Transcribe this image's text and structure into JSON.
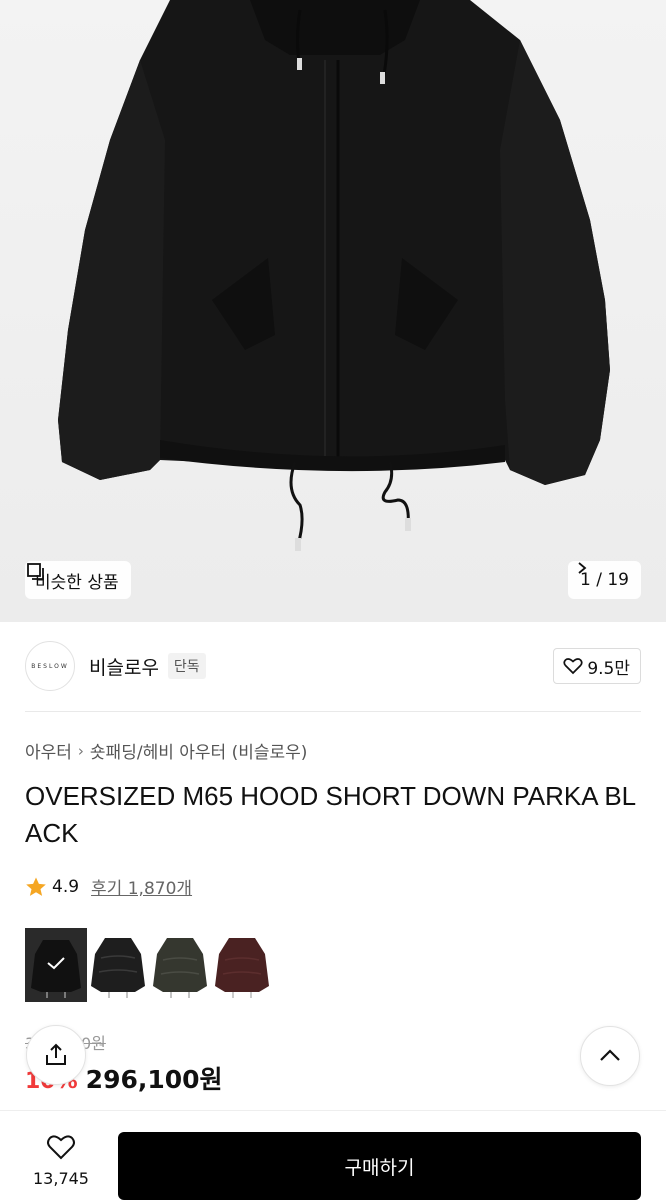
{
  "gallery": {
    "similar_label": "비슷한 상품",
    "counter": "1 / 19"
  },
  "brand": {
    "logo_text": "BESLOW",
    "name": "비슬로우",
    "badge": "단독",
    "likes": "9.5만"
  },
  "breadcrumb": {
    "items": [
      "아우터",
      "숏패딩/헤비 아우터 (비슬로우)"
    ]
  },
  "product": {
    "title": "OVERSIZED M65 HOOD SHORT DOWN PARKA BLACK",
    "rating": "4.9",
    "reviews": "후기 1,870개",
    "original_price": "329,000원",
    "discount": "10%",
    "sale_price": "296,100원"
  },
  "swatches": [
    {
      "color_name": "black",
      "hex": "#1a1a1a",
      "selected": true
    },
    {
      "color_name": "leather-black",
      "hex": "#222222",
      "selected": false
    },
    {
      "color_name": "khaki-black",
      "hex": "#3a3a34",
      "selected": false
    },
    {
      "color_name": "burgundy",
      "hex": "#4a2222",
      "selected": false
    }
  ],
  "bottom": {
    "wish_count": "13,745",
    "buy_label": "구매하기"
  },
  "colors": {
    "accent_red": "#f13a3a",
    "star": "#f5a623",
    "buy_button": "#000000"
  },
  "icons": [
    "copy-icon",
    "chevron-right-icon",
    "heart-icon",
    "star-icon",
    "check-icon",
    "share-icon",
    "chevron-up-icon"
  ]
}
